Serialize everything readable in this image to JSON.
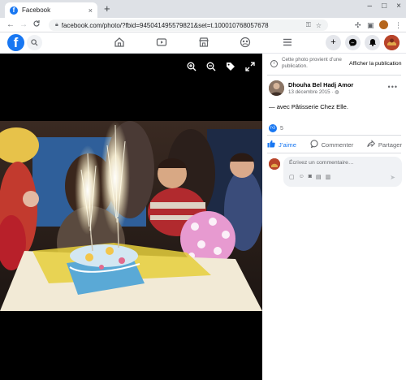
{
  "browser": {
    "tab_title": "Facebook",
    "tab_close": "×",
    "new_tab": "+",
    "window_controls": [
      "–",
      "□",
      "×"
    ],
    "back": "←",
    "forward": "→",
    "reload": "C",
    "url": "facebook.com/photo/?fbid=945041495579821&set=t.100010768057678",
    "icons": [
      "key-icon",
      "star-icon",
      "puzzle-icon",
      "sidebar-icon",
      "profile-avatar-icon",
      "menu-dots-icon"
    ]
  },
  "facebook_header": {
    "logo": "f",
    "nav_icons": [
      "home-icon",
      "video-icon",
      "marketplace-icon",
      "groups-icon",
      "menu-icon"
    ],
    "right_buttons": [
      "+",
      "messenger-icon",
      "notifications-icon",
      "account-avatar"
    ]
  },
  "viewer": {
    "tools": [
      "zoom-in-icon",
      "zoom-out-icon",
      "tag-icon",
      "fullscreen-icon"
    ],
    "colors": {
      "background": "#000000"
    }
  },
  "panel": {
    "notice_text": "Cette photo provient d’une publication.",
    "notice_button": "Afficher la publication",
    "author_name": "Dhouha Bel Hadj Amor",
    "post_date": "13 décembre 2015 · ",
    "caption_prefix": "— avec ",
    "caption_tag": "Pâtisserie Chez Elle",
    "caption_suffix": ".",
    "reaction_count": "5",
    "actions": {
      "like": "J’aime",
      "comment": "Commenter",
      "share": "Partager"
    },
    "comment_placeholder": "Écrivez un commentaire…",
    "colors": {
      "accent": "#1877f2",
      "text_secondary": "#65676b"
    }
  }
}
